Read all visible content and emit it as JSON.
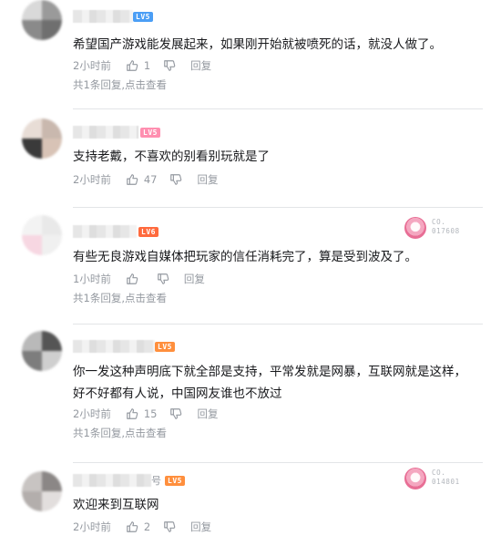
{
  "comments": [
    {
      "level": "LV5",
      "level_color": "#4b9ef5",
      "text": "希望国产游戏能发展起来，如果刚开始就被喷死的话，就没人做了。",
      "time": "2小时前",
      "likes": "1",
      "reply_label": "回复",
      "replies_summary": "共1条回复,",
      "view_link": "点击查看"
    },
    {
      "level": "LV5",
      "level_color": "#ff8fb0",
      "text": "支持老戴，不喜欢的别看别玩就是了",
      "time": "2小时前",
      "likes": "47",
      "reply_label": "回复"
    },
    {
      "level": "LV6",
      "level_color": "#ff6a3d",
      "text": "有些无良游戏自媒体把玩家的信任消耗完了，算是受到波及了。",
      "time": "1小时前",
      "likes": "",
      "reply_label": "回复",
      "replies_summary": "共1条回复,",
      "view_link": "点击查看",
      "badge": {
        "line1": "CO.",
        "line2": "017608"
      }
    },
    {
      "level": "LV5",
      "level_color": "#ff8f3d",
      "text": "你一发这种声明底下就全部是支持，平常发就是网暴，互联网就是这样，\n好不好都有人说，中国网友谁也不放过",
      "time": "2小时前",
      "likes": "15",
      "reply_label": "回复",
      "replies_summary": "共1条回复,",
      "view_link": "点击查看"
    },
    {
      "level": "LV5",
      "level_color": "#ff8f3d",
      "name_suffix": "号",
      "text": "欢迎来到互联网",
      "time": "2小时前",
      "likes": "2",
      "reply_label": "回复",
      "badge": {
        "line1": "CO.",
        "line2": "014801"
      }
    }
  ]
}
